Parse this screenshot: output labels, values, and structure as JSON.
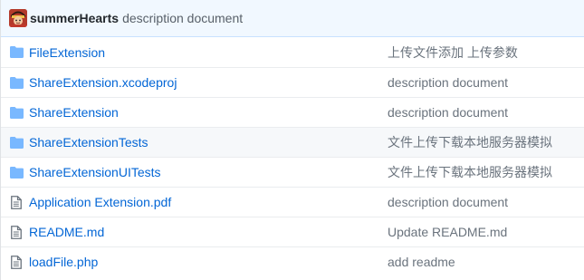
{
  "commit": {
    "author": "summerHearts",
    "message": "description document"
  },
  "files": [
    {
      "type": "folder",
      "icon": "folder-icon",
      "name": "FileExtension",
      "message": "上传文件添加 上传参数"
    },
    {
      "type": "folder",
      "icon": "folder-icon",
      "name": "ShareExtension.xcodeproj",
      "message": "description document"
    },
    {
      "type": "folder",
      "icon": "folder-icon",
      "name": "ShareExtension",
      "message": "description document"
    },
    {
      "type": "folder",
      "icon": "folder-icon",
      "name": "ShareExtensionTests",
      "message": "文件上传下载本地服务器模拟"
    },
    {
      "type": "folder",
      "icon": "folder-icon",
      "name": "ShareExtensionUITests",
      "message": "文件上传下载本地服务器模拟"
    },
    {
      "type": "file",
      "icon": "file-icon",
      "name": "Application Extension.pdf",
      "message": "description document"
    },
    {
      "type": "file",
      "icon": "file-icon",
      "name": "README.md",
      "message": "Update README.md"
    },
    {
      "type": "file",
      "icon": "file-icon",
      "name": "loadFile.php",
      "message": "add readme"
    }
  ],
  "colors": {
    "folder": "#79b8ff",
    "link": "#0366d6",
    "header_bg": "#f1f8ff"
  }
}
